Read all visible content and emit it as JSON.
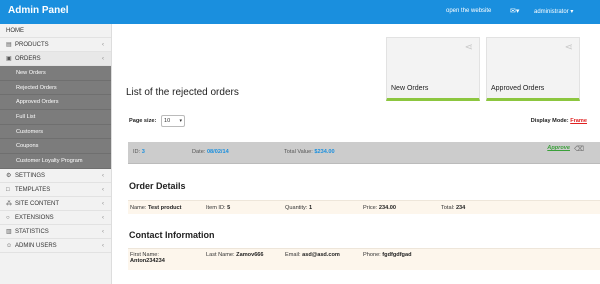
{
  "header": {
    "brand": "Admin Panel",
    "open_website": "open the website",
    "mail_icon": "mail-icon",
    "user": "administrator"
  },
  "sidebar": {
    "items_top": [
      {
        "label": "HOME",
        "icon": "",
        "chevron": false
      },
      {
        "label": "PRODUCTS",
        "icon": "cart-icon",
        "chevron": true
      },
      {
        "label": "ORDERS",
        "icon": "orders-icon",
        "chevron": true
      }
    ],
    "submenu": [
      "New Orders",
      "Rejected Orders",
      "Approved Orders",
      "Full List",
      "Customers",
      "Coupons",
      "Customer Loyalty Program"
    ],
    "items_bottom": [
      {
        "label": "SETTINGS",
        "icon": "gears-icon"
      },
      {
        "label": "TEMPLATES",
        "icon": "template-icon"
      },
      {
        "label": "SITE CONTENT",
        "icon": "sitemap-icon"
      },
      {
        "label": "EXTENSIONS",
        "icon": "extensions-icon"
      },
      {
        "label": "STATISTICS",
        "icon": "chart-icon"
      },
      {
        "label": "ADMIN USERS",
        "icon": "users-icon"
      }
    ]
  },
  "cards": [
    {
      "label": "New Orders",
      "icon": "share-icon"
    },
    {
      "label": "Approved Orders",
      "icon": "share-icon"
    }
  ],
  "page": {
    "title": "List of the rejected orders",
    "page_size_label": "Page size:",
    "page_size_value": "10",
    "display_mode_label": "Display Mode:",
    "display_mode_value": "Frame"
  },
  "order": {
    "id_label": "ID:",
    "id_value": "3",
    "date_label": "Date:",
    "date_value": "08/02/14",
    "total_label": "Total Value:",
    "total_value": "$234.00",
    "approve": "Approve",
    "delete_icon": "trash-icon"
  },
  "details": {
    "title": "Order Details",
    "name_label": "Name:",
    "name_value": "Test product",
    "item_label": "Item ID:",
    "item_value": "5",
    "qty_label": "Quantity:",
    "qty_value": "1",
    "price_label": "Price:",
    "price_value": "234.00",
    "total_label": "Total:",
    "total_value": "234"
  },
  "contact": {
    "title": "Contact Information",
    "first_label": "First Name:",
    "first_value": "Anton234234",
    "last_label": "Last Name:",
    "last_value": "Zamov666",
    "email_label": "Email:",
    "email_value": "asd@asd.com",
    "phone_label": "Phone:",
    "phone_value": "fgdfgdfgad"
  },
  "colors": {
    "topbar": "#1a8fde",
    "accent_green": "#8cc63f",
    "submenu_bg": "#7c7c7c",
    "link_blue": "#1a8fde",
    "frame_red": "#e02020"
  }
}
